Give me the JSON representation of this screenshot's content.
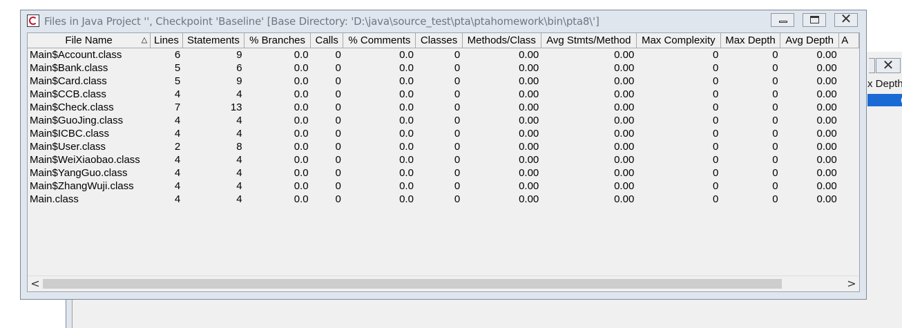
{
  "background_window": {
    "header_partial": "x Depth",
    "selected_value_partial": "0"
  },
  "window": {
    "title": "Files in Java Project '', Checkpoint 'Baseline'  [Base Directory: 'D:\\java\\source_test\\pta\\ptahomework\\bin\\pta8\\']",
    "icon": "sourcemonitor-app-icon"
  },
  "table": {
    "sorted_column_indicator": "△",
    "columns": [
      "File Name",
      "Lines",
      "Statements",
      "% Branches",
      "Calls",
      "% Comments",
      "Classes",
      "Methods/Class",
      "Avg Stmts/Method",
      "Max Complexity",
      "Max Depth",
      "Avg Depth",
      "A"
    ],
    "rows": [
      [
        "Main$Account.class",
        "6",
        "9",
        "0.0",
        "0",
        "0.0",
        "0",
        "0.00",
        "0.00",
        "0",
        "0",
        "0.00"
      ],
      [
        "Main$Bank.class",
        "5",
        "6",
        "0.0",
        "0",
        "0.0",
        "0",
        "0.00",
        "0.00",
        "0",
        "0",
        "0.00"
      ],
      [
        "Main$Card.class",
        "5",
        "9",
        "0.0",
        "0",
        "0.0",
        "0",
        "0.00",
        "0.00",
        "0",
        "0",
        "0.00"
      ],
      [
        "Main$CCB.class",
        "4",
        "4",
        "0.0",
        "0",
        "0.0",
        "0",
        "0.00",
        "0.00",
        "0",
        "0",
        "0.00"
      ],
      [
        "Main$Check.class",
        "7",
        "13",
        "0.0",
        "0",
        "0.0",
        "0",
        "0.00",
        "0.00",
        "0",
        "0",
        "0.00"
      ],
      [
        "Main$GuoJing.class",
        "4",
        "4",
        "0.0",
        "0",
        "0.0",
        "0",
        "0.00",
        "0.00",
        "0",
        "0",
        "0.00"
      ],
      [
        "Main$ICBC.class",
        "4",
        "4",
        "0.0",
        "0",
        "0.0",
        "0",
        "0.00",
        "0.00",
        "0",
        "0",
        "0.00"
      ],
      [
        "Main$User.class",
        "2",
        "8",
        "0.0",
        "0",
        "0.0",
        "0",
        "0.00",
        "0.00",
        "0",
        "0",
        "0.00"
      ],
      [
        "Main$WeiXiaobao.class",
        "4",
        "4",
        "0.0",
        "0",
        "0.0",
        "0",
        "0.00",
        "0.00",
        "0",
        "0",
        "0.00"
      ],
      [
        "Main$YangGuo.class",
        "4",
        "4",
        "0.0",
        "0",
        "0.0",
        "0",
        "0.00",
        "0.00",
        "0",
        "0",
        "0.00"
      ],
      [
        "Main$ZhangWuji.class",
        "4",
        "4",
        "0.0",
        "0",
        "0.0",
        "0",
        "0.00",
        "0.00",
        "0",
        "0",
        "0.00"
      ],
      [
        "Main.class",
        "4",
        "4",
        "0.0",
        "0",
        "0.0",
        "0",
        "0.00",
        "0.00",
        "0",
        "0",
        "0.00"
      ]
    ]
  },
  "scrollbar": {
    "left_arrow": "<",
    "right_arrow": ">"
  },
  "colors": {
    "window_frame": "#dfe6ee",
    "client_bg": "#f0f0f0",
    "selection": "#1a6ad6",
    "title_text": "#6d7783"
  }
}
